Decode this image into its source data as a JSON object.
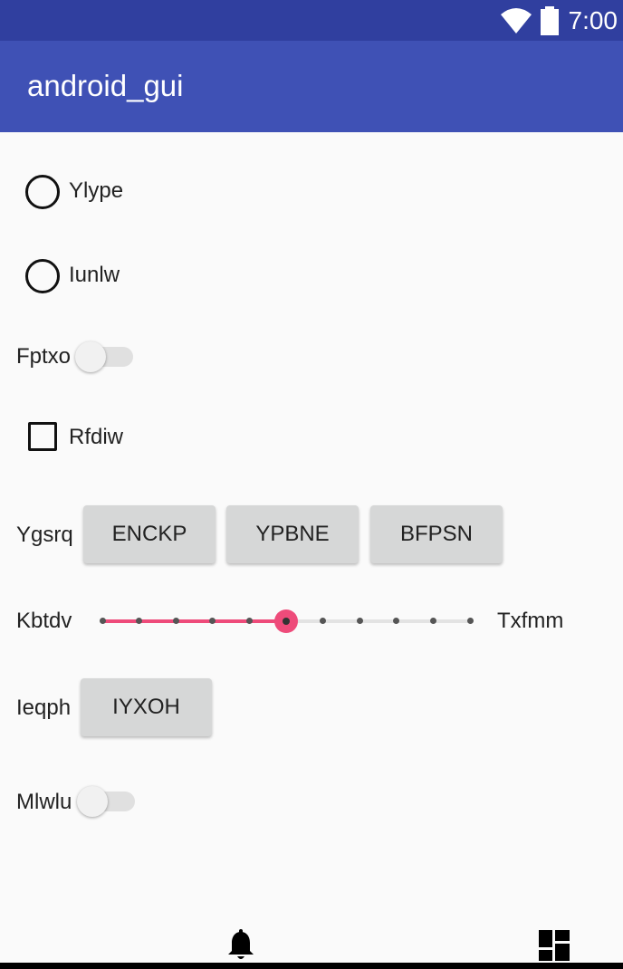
{
  "status_bar": {
    "time": "7:00",
    "icons": [
      "wifi-icon",
      "battery-icon"
    ]
  },
  "app_bar": {
    "title": "android_gui"
  },
  "radios": [
    {
      "label": "Ylype",
      "checked": false
    },
    {
      "label": "Iunlw",
      "checked": false
    }
  ],
  "switches": [
    {
      "label": "Fptxo",
      "on": false
    },
    {
      "label": "Mlwlu",
      "on": false
    }
  ],
  "checkbox": {
    "label": "Rfdiw",
    "checked": false
  },
  "button_row_1": {
    "label": "Ygsrq",
    "buttons": [
      "ENCKP",
      "YPBNE",
      "BFPSN"
    ]
  },
  "slider": {
    "min_label": "Kbtdv",
    "max_label": "Txfmm",
    "value": 5,
    "max": 10
  },
  "button_row_2": {
    "label": "Ieqph",
    "buttons": [
      "IYXOH"
    ]
  },
  "bottom_nav": {
    "icons": [
      "bell-icon",
      "dashboard-icon"
    ]
  },
  "colors": {
    "primary": "#3f51b5",
    "primary_dark": "#303f9f",
    "accent": "#ee4b7a"
  }
}
